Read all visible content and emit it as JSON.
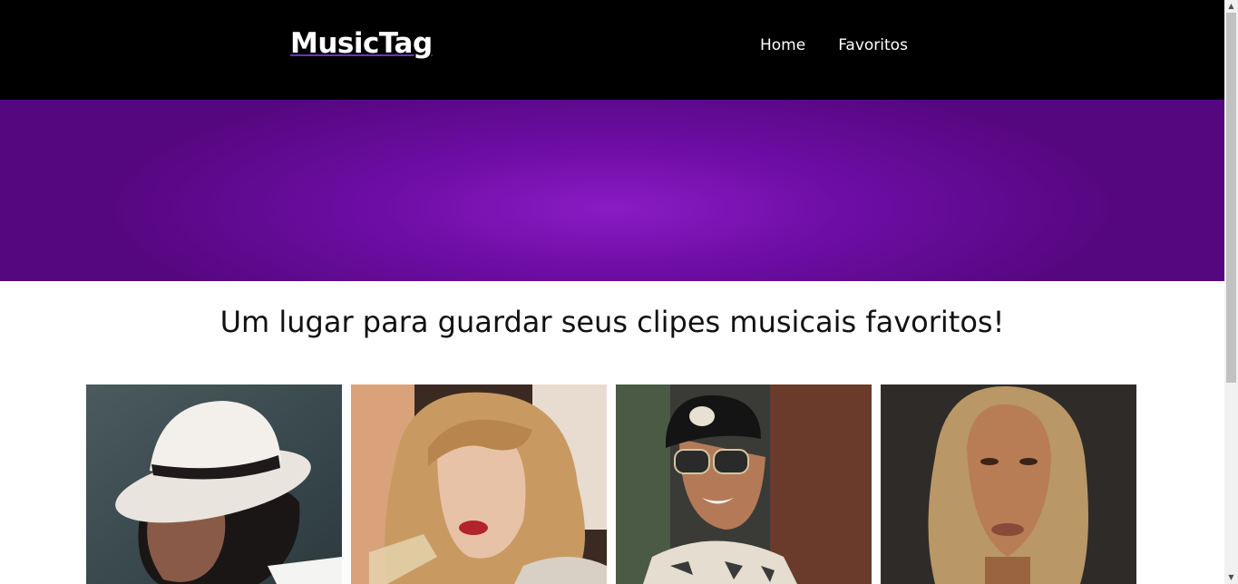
{
  "header": {
    "logo": "MusicTag",
    "nav": [
      {
        "label": "Home"
      },
      {
        "label": "Favoritos"
      }
    ]
  },
  "main": {
    "tagline": "Um lugar para guardar seus clipes musicais favoritos!"
  },
  "cards": [
    {
      "image": "artist-photo-white-fedora"
    },
    {
      "image": "artist-photo-blonde-glass"
    },
    {
      "image": "artist-photo-cap-sunglasses"
    },
    {
      "image": "artist-photo-long-hair"
    }
  ],
  "colors": {
    "header_bg": "#000000",
    "hero_center": "#8a1cc4",
    "hero_edge": "#55077f",
    "logo_underline": "#6b2fd6"
  },
  "icons": {
    "scroll_up": "▲",
    "scroll_down": "▼"
  }
}
